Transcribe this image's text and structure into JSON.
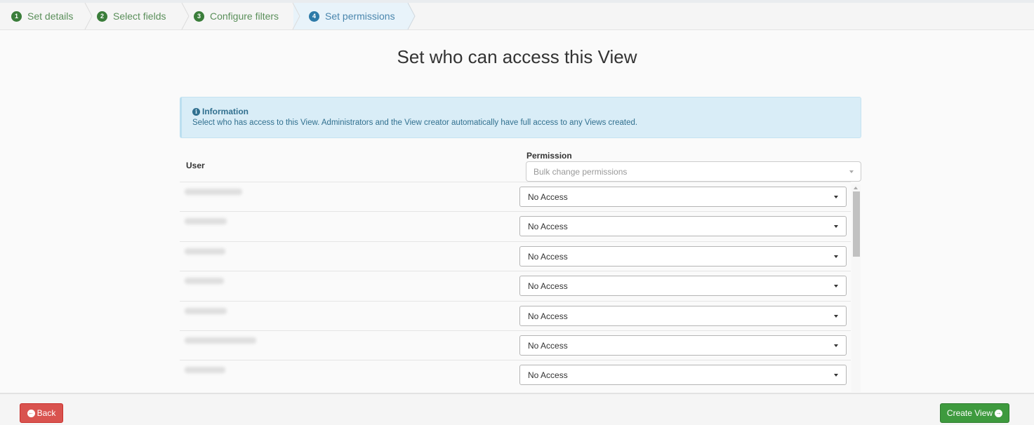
{
  "wizard": {
    "steps": [
      {
        "number": "1",
        "label": "Set details",
        "state": "complete"
      },
      {
        "number": "2",
        "label": "Select fields",
        "state": "complete"
      },
      {
        "number": "3",
        "label": "Configure filters",
        "state": "complete"
      },
      {
        "number": "4",
        "label": "Set permissions",
        "state": "active"
      }
    ]
  },
  "page": {
    "title": "Set who can access this View"
  },
  "info": {
    "icon": "info-circle-icon",
    "heading": "Information",
    "text": "Select who has access to this View. Administrators and the View creator automatically have full access to any Views created."
  },
  "table": {
    "user_header": "User",
    "permission_header": "Permission",
    "bulk_placeholder": "Bulk change permissions",
    "rows": [
      {
        "user": "[redacted]",
        "permission": "No Access"
      },
      {
        "user": "[redacted]",
        "permission": "No Access"
      },
      {
        "user": "[redacted]",
        "permission": "No Access"
      },
      {
        "user": "[redacted]",
        "permission": "No Access"
      },
      {
        "user": "[redacted]",
        "permission": "No Access"
      },
      {
        "user": "[redacted]",
        "permission": "No Access"
      },
      {
        "user": "[redacted]",
        "permission": "No Access"
      }
    ]
  },
  "footer": {
    "back_label": "Back",
    "back_icon": "arrow-circle-left-icon",
    "create_label": "Create View",
    "create_icon": "arrow-circle-right-icon"
  },
  "colors": {
    "step_complete": "#3a7d3a",
    "step_active": "#2d7aa8",
    "info_bg": "#d9edf7",
    "info_text": "#31708f",
    "back_button": "#d9534f",
    "create_button": "#3e9a3e"
  }
}
